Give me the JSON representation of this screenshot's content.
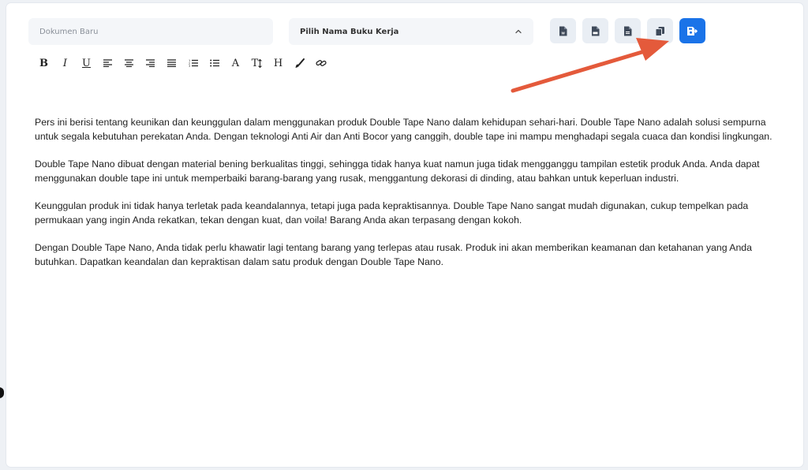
{
  "document": {
    "name_placeholder": "Dokumen Baru",
    "name_value": ""
  },
  "workbook_select": {
    "label": "Pilih Nama Buku Kerja",
    "icon": "chevron-up-icon"
  },
  "actions": [
    {
      "icon": "word-file-icon",
      "tooltip": ""
    },
    {
      "icon": "pdf-file-icon",
      "tooltip": ""
    },
    {
      "icon": "text-file-icon",
      "tooltip": ""
    },
    {
      "icon": "copy-icon",
      "tooltip": ""
    },
    {
      "icon": "save-file-icon",
      "tooltip": ""
    }
  ],
  "toolbar": {
    "bold": "B",
    "italic": "I",
    "underline": "U",
    "font_color": "A",
    "font_size": "T",
    "heading": "H"
  },
  "colors": {
    "primary": "#1a73e8",
    "arrow": "#e45a3b"
  },
  "content": {
    "paragraphs": [
      "Pers ini berisi tentang keunikan dan keunggulan dalam menggunakan produk Double Tape Nano dalam kehidupan sehari-hari. Double Tape Nano adalah solusi sempurna untuk segala kebutuhan perekatan Anda. Dengan teknologi Anti Air dan Anti Bocor yang canggih, double tape ini mampu menghadapi segala cuaca dan kondisi lingkungan.",
      "Double Tape Nano dibuat dengan material bening berkualitas tinggi, sehingga tidak hanya kuat namun juga tidak mengganggu tampilan estetik produk Anda. Anda dapat menggunakan double tape ini untuk memperbaiki barang-barang yang rusak, menggantung dekorasi di dinding, atau bahkan untuk keperluan industri.",
      "Keunggulan produk ini tidak hanya terletak pada keandalannya, tetapi juga pada kepraktisannya. Double Tape Nano sangat mudah digunakan, cukup tempelkan pada permukaan yang ingin Anda rekatkan, tekan dengan kuat, dan voila! Barang Anda akan terpasang dengan kokoh.",
      "Dengan Double Tape Nano, Anda tidak perlu khawatir lagi tentang barang yang terlepas atau rusak. Produk ini akan memberikan keamanan dan ketahanan yang Anda butuhkan. Dapatkan keandalan dan kepraktisan dalam satu produk dengan Double Tape Nano."
    ]
  }
}
